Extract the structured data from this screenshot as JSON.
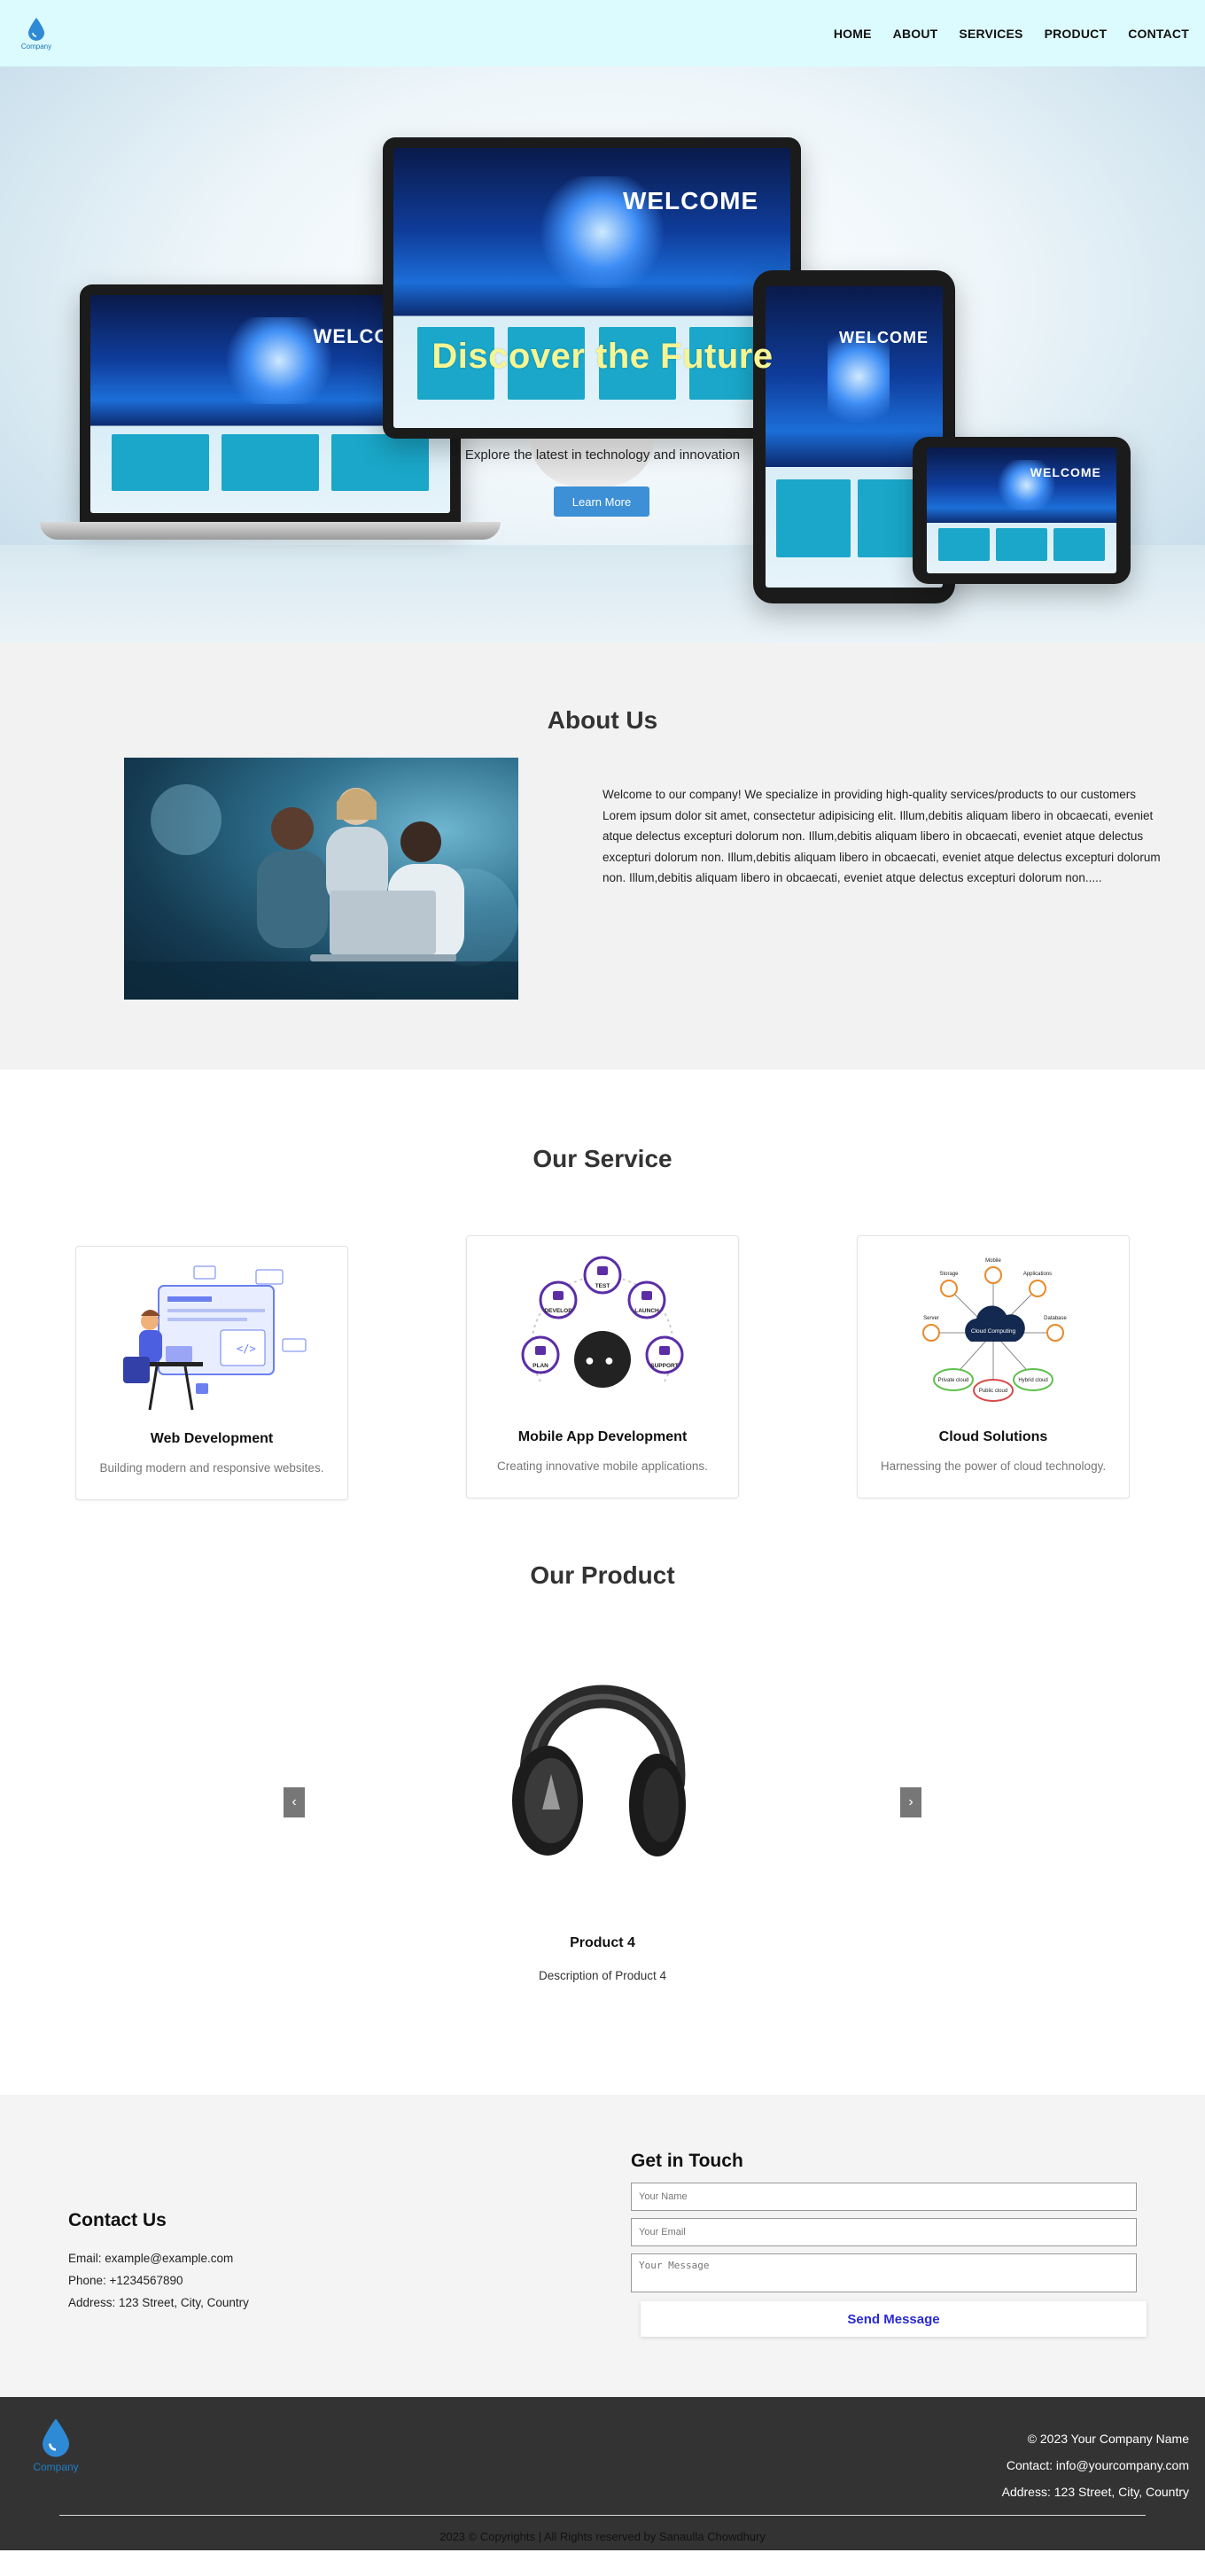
{
  "nav": {
    "logo_text": "Company",
    "items": [
      "HOME",
      "ABOUT",
      "SERVICES",
      "PRODUCT",
      "CONTACT"
    ]
  },
  "hero": {
    "screen_text": "WELCOME",
    "title": "Discover the Future",
    "subtitle": "Explore the latest in technology and innovation",
    "button": "Learn More"
  },
  "about": {
    "title": "About Us",
    "text": "Welcome to our company! We specialize in providing high-quality services/products to our customers Lorem ipsum dolor sit amet, consectetur adipisicing elit. Illum,debitis aliquam libero in obcaecati, eveniet atque delectus excepturi dolorum non. Illum,debitis aliquam libero in obcaecati, eveniet atque delectus excepturi dolorum non. Illum,debitis aliquam libero in obcaecati, eveniet atque delectus excepturi dolorum non. Illum,debitis aliquam libero in obcaecati, eveniet atque delectus excepturi dolorum non....."
  },
  "services": {
    "title": "Our Service",
    "cards": [
      {
        "title": "Web Development",
        "desc": "Building modern and responsive websites.",
        "icon": "web-development-illustration"
      },
      {
        "title": "Mobile App Development",
        "desc": "Creating innovative mobile applications.",
        "icon": "mobile-app-illustration",
        "steps": [
          "DEVELOP",
          "TEST",
          "LAUNCH",
          "PLAN",
          "SUPPORT"
        ]
      },
      {
        "title": "Cloud Solutions",
        "desc": "Harnessing the power of cloud technology.",
        "icon": "cloud-computing-illustration",
        "nodes": [
          "Storage",
          "Mobile",
          "Applications",
          "Server",
          "Database",
          "Private cloud",
          "Public cloud",
          "Hybrid cloud"
        ],
        "center": "Cloud Computing"
      }
    ]
  },
  "product": {
    "title": "Our Product",
    "name": "Product 4",
    "desc": "Description of Product 4",
    "prev": "‹",
    "next": "›"
  },
  "contact": {
    "title": "Contact Us",
    "email": "Email: example@example.com",
    "phone": "Phone: +1234567890",
    "address": "Address: 123 Street, City, Country",
    "form_title": "Get in Touch",
    "name_placeholder": "Your Name",
    "email_placeholder": "Your Email",
    "message_placeholder": "Your Message",
    "send": "Send Message"
  },
  "footer": {
    "logo_text": "Company",
    "copyright_company": "© 2023 Your Company Name",
    "contact": "Contact: info@yourcompany.com",
    "address": "Address: 123 Street, City, Country",
    "bottom": "2023 © Copyrights | All Rights reserved by Sanaulla Chowdhury"
  },
  "colors": {
    "nav_bg": "#dcfbfe",
    "hero_title": "#f6f594",
    "button_blue": "#3d8fd6",
    "footer_bg": "#333333",
    "send_text": "#2a2ad6"
  }
}
